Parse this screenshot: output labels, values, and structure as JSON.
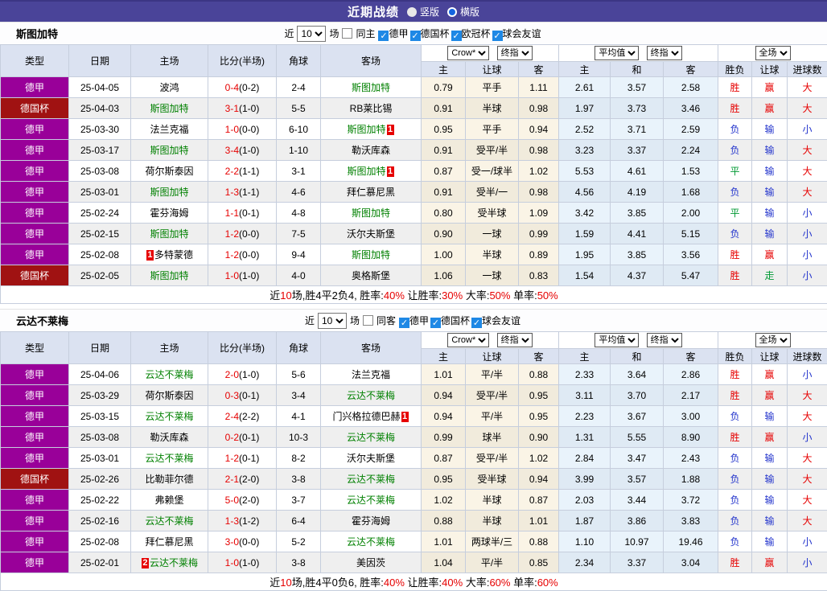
{
  "topbar": {
    "title": "近期战绩",
    "vertical_label": "竖版",
    "horizontal_label": "横版",
    "selected": "横版"
  },
  "labels": {
    "near": "近",
    "count": "10",
    "matches": "场"
  },
  "table_header": {
    "type": "类型",
    "date": "日期",
    "home": "主场",
    "score": "比分(半场)",
    "corner": "角球",
    "away": "客场",
    "asian_source": "Crow*",
    "asian_time": "终指",
    "euro_source": "平均值",
    "euro_time": "终指",
    "scope": "全场",
    "asian_home": "主",
    "asian_hcap": "让球",
    "asian_away": "客",
    "euro_home": "主",
    "euro_draw": "和",
    "euro_away": "客",
    "res_wdl": "胜负",
    "res_hcap": "让球",
    "res_goals": "进球数"
  },
  "league_colors": {
    "德甲": "#990099",
    "德国杯": "#a01212"
  },
  "result_colors": {
    "胜": "#e60000",
    "平": "#009933",
    "负": "#2233cc",
    "赢": "#e60000",
    "输": "#2233cc",
    "走": "#009933",
    "大": "#e60000",
    "小": "#2233cc"
  },
  "sections": [
    {
      "team": "斯图加特",
      "filter": {
        "same_label": "同主",
        "same_checked": false,
        "leagues": [
          "德甲",
          "德国杯",
          "欧冠杯",
          "球会友谊"
        ]
      },
      "rows": [
        {
          "league": "德甲",
          "date": "25-04-05",
          "home": {
            "name": "波鸿"
          },
          "ft": "0-4",
          "ht": "(0-2)",
          "corner": "2-4",
          "away": {
            "name": "斯图加特",
            "green": true
          },
          "asian": [
            "0.79",
            "平手",
            "1.11"
          ],
          "euro": [
            "2.61",
            "3.57",
            "2.58"
          ],
          "results": [
            "胜",
            "赢",
            "大"
          ]
        },
        {
          "league": "德国杯",
          "date": "25-04-03",
          "home": {
            "name": "斯图加特",
            "green": true
          },
          "ft": "3-1",
          "ht": "(1-0)",
          "corner": "5-5",
          "away": {
            "name": "RB莱比锡"
          },
          "asian": [
            "0.91",
            "半球",
            "0.98"
          ],
          "euro": [
            "1.97",
            "3.73",
            "3.46"
          ],
          "results": [
            "胜",
            "赢",
            "大"
          ]
        },
        {
          "league": "德甲",
          "date": "25-03-30",
          "home": {
            "name": "法兰克福"
          },
          "ft": "1-0",
          "ht": "(0-0)",
          "corner": "6-10",
          "away": {
            "name": "斯图加特",
            "green": true,
            "badge": "1",
            "badge_pos": "after"
          },
          "asian": [
            "0.95",
            "平手",
            "0.94"
          ],
          "euro": [
            "2.52",
            "3.71",
            "2.59"
          ],
          "results": [
            "负",
            "输",
            "小"
          ]
        },
        {
          "league": "德甲",
          "date": "25-03-17",
          "home": {
            "name": "斯图加特",
            "green": true
          },
          "ft": "3-4",
          "ht": "(1-0)",
          "corner": "1-10",
          "away": {
            "name": "勒沃库森"
          },
          "asian": [
            "0.91",
            "受平/半",
            "0.98"
          ],
          "euro": [
            "3.23",
            "3.37",
            "2.24"
          ],
          "results": [
            "负",
            "输",
            "大"
          ]
        },
        {
          "league": "德甲",
          "date": "25-03-08",
          "home": {
            "name": "荷尔斯泰因"
          },
          "ft": "2-2",
          "ht": "(1-1)",
          "corner": "3-1",
          "away": {
            "name": "斯图加特",
            "green": true,
            "badge": "1",
            "badge_pos": "after"
          },
          "asian": [
            "0.87",
            "受一/球半",
            "1.02"
          ],
          "euro": [
            "5.53",
            "4.61",
            "1.53"
          ],
          "results": [
            "平",
            "输",
            "大"
          ]
        },
        {
          "league": "德甲",
          "date": "25-03-01",
          "home": {
            "name": "斯图加特",
            "green": true
          },
          "ft": "1-3",
          "ht": "(1-1)",
          "corner": "4-6",
          "away": {
            "name": "拜仁慕尼黑"
          },
          "asian": [
            "0.91",
            "受半/一",
            "0.98"
          ],
          "euro": [
            "4.56",
            "4.19",
            "1.68"
          ],
          "results": [
            "负",
            "输",
            "大"
          ]
        },
        {
          "league": "德甲",
          "date": "25-02-24",
          "home": {
            "name": "霍芬海姆"
          },
          "ft": "1-1",
          "ht": "(0-1)",
          "corner": "4-8",
          "away": {
            "name": "斯图加特",
            "green": true
          },
          "asian": [
            "0.80",
            "受半球",
            "1.09"
          ],
          "euro": [
            "3.42",
            "3.85",
            "2.00"
          ],
          "results": [
            "平",
            "输",
            "小"
          ]
        },
        {
          "league": "德甲",
          "date": "25-02-15",
          "home": {
            "name": "斯图加特",
            "green": true
          },
          "ft": "1-2",
          "ht": "(0-0)",
          "corner": "7-5",
          "away": {
            "name": "沃尔夫斯堡"
          },
          "asian": [
            "0.90",
            "一球",
            "0.99"
          ],
          "euro": [
            "1.59",
            "4.41",
            "5.15"
          ],
          "results": [
            "负",
            "输",
            "小"
          ]
        },
        {
          "league": "德甲",
          "date": "25-02-08",
          "home": {
            "name": "多特蒙德",
            "badge": "1",
            "badge_pos": "before"
          },
          "ft": "1-2",
          "ht": "(0-0)",
          "corner": "9-4",
          "away": {
            "name": "斯图加特",
            "green": true
          },
          "asian": [
            "1.00",
            "半球",
            "0.89"
          ],
          "euro": [
            "1.95",
            "3.85",
            "3.56"
          ],
          "results": [
            "胜",
            "赢",
            "小"
          ]
        },
        {
          "league": "德国杯",
          "date": "25-02-05",
          "home": {
            "name": "斯图加特",
            "green": true
          },
          "ft": "1-0",
          "ht": "(1-0)",
          "corner": "4-0",
          "away": {
            "name": "奥格斯堡"
          },
          "asian": [
            "1.06",
            "一球",
            "0.83"
          ],
          "euro": [
            "1.54",
            "4.37",
            "5.47"
          ],
          "results": [
            "胜",
            "走",
            "小"
          ]
        }
      ],
      "summary": [
        [
          "近",
          false
        ],
        [
          "10",
          true
        ],
        [
          "场,胜4平2负4, 胜率:",
          false
        ],
        [
          "40%",
          true
        ],
        [
          " 让胜率:",
          false
        ],
        [
          "30%",
          true
        ],
        [
          " 大率:",
          false
        ],
        [
          "50%",
          true
        ],
        [
          " 单率:",
          false
        ],
        [
          "50%",
          true
        ]
      ]
    },
    {
      "team": "云达不莱梅",
      "filter": {
        "same_label": "同客",
        "same_checked": false,
        "leagues": [
          "德甲",
          "德国杯",
          "球会友谊"
        ]
      },
      "rows": [
        {
          "league": "德甲",
          "date": "25-04-06",
          "home": {
            "name": "云达不莱梅",
            "green": true
          },
          "ft": "2-0",
          "ht": "(1-0)",
          "corner": "5-6",
          "away": {
            "name": "法兰克福"
          },
          "asian": [
            "1.01",
            "平/半",
            "0.88"
          ],
          "euro": [
            "2.33",
            "3.64",
            "2.86"
          ],
          "results": [
            "胜",
            "赢",
            "小"
          ]
        },
        {
          "league": "德甲",
          "date": "25-03-29",
          "home": {
            "name": "荷尔斯泰因"
          },
          "ft": "0-3",
          "ht": "(0-1)",
          "corner": "3-4",
          "away": {
            "name": "云达不莱梅",
            "green": true
          },
          "asian": [
            "0.94",
            "受平/半",
            "0.95"
          ],
          "euro": [
            "3.11",
            "3.70",
            "2.17"
          ],
          "results": [
            "胜",
            "赢",
            "大"
          ]
        },
        {
          "league": "德甲",
          "date": "25-03-15",
          "home": {
            "name": "云达不莱梅",
            "green": true
          },
          "ft": "2-4",
          "ht": "(2-2)",
          "corner": "4-1",
          "away": {
            "name": "门兴格拉德巴赫",
            "badge": "1",
            "badge_pos": "after"
          },
          "asian": [
            "0.94",
            "平/半",
            "0.95"
          ],
          "euro": [
            "2.23",
            "3.67",
            "3.00"
          ],
          "results": [
            "负",
            "输",
            "大"
          ]
        },
        {
          "league": "德甲",
          "date": "25-03-08",
          "home": {
            "name": "勒沃库森"
          },
          "ft": "0-2",
          "ht": "(0-1)",
          "corner": "10-3",
          "away": {
            "name": "云达不莱梅",
            "green": true
          },
          "asian": [
            "0.99",
            "球半",
            "0.90"
          ],
          "euro": [
            "1.31",
            "5.55",
            "8.90"
          ],
          "results": [
            "胜",
            "赢",
            "小"
          ]
        },
        {
          "league": "德甲",
          "date": "25-03-01",
          "home": {
            "name": "云达不莱梅",
            "green": true
          },
          "ft": "1-2",
          "ht": "(0-1)",
          "corner": "8-2",
          "away": {
            "name": "沃尔夫斯堡"
          },
          "asian": [
            "0.87",
            "受平/半",
            "1.02"
          ],
          "euro": [
            "2.84",
            "3.47",
            "2.43"
          ],
          "results": [
            "负",
            "输",
            "大"
          ]
        },
        {
          "league": "德国杯",
          "date": "25-02-26",
          "home": {
            "name": "比勒菲尔德"
          },
          "ft": "2-1",
          "ht": "(2-0)",
          "corner": "3-8",
          "away": {
            "name": "云达不莱梅",
            "green": true
          },
          "asian": [
            "0.95",
            "受半球",
            "0.94"
          ],
          "euro": [
            "3.99",
            "3.57",
            "1.88"
          ],
          "results": [
            "负",
            "输",
            "大"
          ]
        },
        {
          "league": "德甲",
          "date": "25-02-22",
          "home": {
            "name": "弗赖堡"
          },
          "ft": "5-0",
          "ht": "(2-0)",
          "corner": "3-7",
          "away": {
            "name": "云达不莱梅",
            "green": true
          },
          "asian": [
            "1.02",
            "半球",
            "0.87"
          ],
          "euro": [
            "2.03",
            "3.44",
            "3.72"
          ],
          "results": [
            "负",
            "输",
            "大"
          ]
        },
        {
          "league": "德甲",
          "date": "25-02-16",
          "home": {
            "name": "云达不莱梅",
            "green": true
          },
          "ft": "1-3",
          "ht": "(1-2)",
          "corner": "6-4",
          "away": {
            "name": "霍芬海姆"
          },
          "asian": [
            "0.88",
            "半球",
            "1.01"
          ],
          "euro": [
            "1.87",
            "3.86",
            "3.83"
          ],
          "results": [
            "负",
            "输",
            "大"
          ]
        },
        {
          "league": "德甲",
          "date": "25-02-08",
          "home": {
            "name": "拜仁慕尼黑"
          },
          "ft": "3-0",
          "ht": "(0-0)",
          "corner": "5-2",
          "away": {
            "name": "云达不莱梅",
            "green": true
          },
          "asian": [
            "1.01",
            "两球半/三",
            "0.88"
          ],
          "euro": [
            "1.10",
            "10.97",
            "19.46"
          ],
          "results": [
            "负",
            "输",
            "小"
          ]
        },
        {
          "league": "德甲",
          "date": "25-02-01",
          "home": {
            "name": "云达不莱梅",
            "green": true,
            "badge": "2",
            "badge_pos": "before"
          },
          "ft": "1-0",
          "ht": "(1-0)",
          "corner": "3-8",
          "away": {
            "name": "美因茨"
          },
          "asian": [
            "1.04",
            "平/半",
            "0.85"
          ],
          "euro": [
            "2.34",
            "3.37",
            "3.04"
          ],
          "results": [
            "胜",
            "赢",
            "小"
          ]
        }
      ],
      "summary": [
        [
          "近",
          false
        ],
        [
          "10",
          true
        ],
        [
          "场,胜4平0负6, 胜率:",
          false
        ],
        [
          "40%",
          true
        ],
        [
          " 让胜率:",
          false
        ],
        [
          "40%",
          true
        ],
        [
          " 大率:",
          false
        ],
        [
          "60%",
          true
        ],
        [
          " 单率:",
          false
        ],
        [
          "60%",
          true
        ]
      ]
    }
  ]
}
